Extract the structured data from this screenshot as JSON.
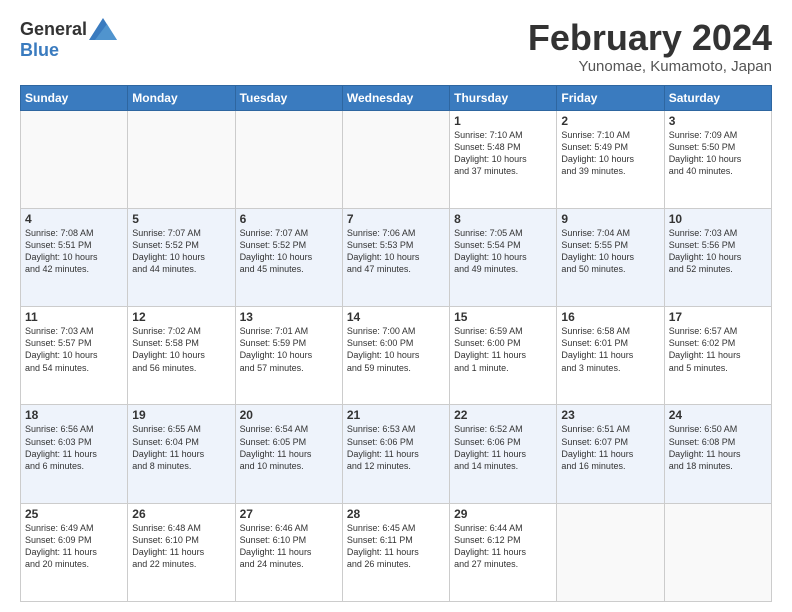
{
  "header": {
    "logo_general": "General",
    "logo_blue": "Blue",
    "title": "February 2024",
    "location": "Yunomae, Kumamoto, Japan"
  },
  "weekdays": [
    "Sunday",
    "Monday",
    "Tuesday",
    "Wednesday",
    "Thursday",
    "Friday",
    "Saturday"
  ],
  "weeks": [
    [
      {
        "day": "",
        "info": ""
      },
      {
        "day": "",
        "info": ""
      },
      {
        "day": "",
        "info": ""
      },
      {
        "day": "",
        "info": ""
      },
      {
        "day": "1",
        "info": "Sunrise: 7:10 AM\nSunset: 5:48 PM\nDaylight: 10 hours\nand 37 minutes."
      },
      {
        "day": "2",
        "info": "Sunrise: 7:10 AM\nSunset: 5:49 PM\nDaylight: 10 hours\nand 39 minutes."
      },
      {
        "day": "3",
        "info": "Sunrise: 7:09 AM\nSunset: 5:50 PM\nDaylight: 10 hours\nand 40 minutes."
      }
    ],
    [
      {
        "day": "4",
        "info": "Sunrise: 7:08 AM\nSunset: 5:51 PM\nDaylight: 10 hours\nand 42 minutes."
      },
      {
        "day": "5",
        "info": "Sunrise: 7:07 AM\nSunset: 5:52 PM\nDaylight: 10 hours\nand 44 minutes."
      },
      {
        "day": "6",
        "info": "Sunrise: 7:07 AM\nSunset: 5:52 PM\nDaylight: 10 hours\nand 45 minutes."
      },
      {
        "day": "7",
        "info": "Sunrise: 7:06 AM\nSunset: 5:53 PM\nDaylight: 10 hours\nand 47 minutes."
      },
      {
        "day": "8",
        "info": "Sunrise: 7:05 AM\nSunset: 5:54 PM\nDaylight: 10 hours\nand 49 minutes."
      },
      {
        "day": "9",
        "info": "Sunrise: 7:04 AM\nSunset: 5:55 PM\nDaylight: 10 hours\nand 50 minutes."
      },
      {
        "day": "10",
        "info": "Sunrise: 7:03 AM\nSunset: 5:56 PM\nDaylight: 10 hours\nand 52 minutes."
      }
    ],
    [
      {
        "day": "11",
        "info": "Sunrise: 7:03 AM\nSunset: 5:57 PM\nDaylight: 10 hours\nand 54 minutes."
      },
      {
        "day": "12",
        "info": "Sunrise: 7:02 AM\nSunset: 5:58 PM\nDaylight: 10 hours\nand 56 minutes."
      },
      {
        "day": "13",
        "info": "Sunrise: 7:01 AM\nSunset: 5:59 PM\nDaylight: 10 hours\nand 57 minutes."
      },
      {
        "day": "14",
        "info": "Sunrise: 7:00 AM\nSunset: 6:00 PM\nDaylight: 10 hours\nand 59 minutes."
      },
      {
        "day": "15",
        "info": "Sunrise: 6:59 AM\nSunset: 6:00 PM\nDaylight: 11 hours\nand 1 minute."
      },
      {
        "day": "16",
        "info": "Sunrise: 6:58 AM\nSunset: 6:01 PM\nDaylight: 11 hours\nand 3 minutes."
      },
      {
        "day": "17",
        "info": "Sunrise: 6:57 AM\nSunset: 6:02 PM\nDaylight: 11 hours\nand 5 minutes."
      }
    ],
    [
      {
        "day": "18",
        "info": "Sunrise: 6:56 AM\nSunset: 6:03 PM\nDaylight: 11 hours\nand 6 minutes."
      },
      {
        "day": "19",
        "info": "Sunrise: 6:55 AM\nSunset: 6:04 PM\nDaylight: 11 hours\nand 8 minutes."
      },
      {
        "day": "20",
        "info": "Sunrise: 6:54 AM\nSunset: 6:05 PM\nDaylight: 11 hours\nand 10 minutes."
      },
      {
        "day": "21",
        "info": "Sunrise: 6:53 AM\nSunset: 6:06 PM\nDaylight: 11 hours\nand 12 minutes."
      },
      {
        "day": "22",
        "info": "Sunrise: 6:52 AM\nSunset: 6:06 PM\nDaylight: 11 hours\nand 14 minutes."
      },
      {
        "day": "23",
        "info": "Sunrise: 6:51 AM\nSunset: 6:07 PM\nDaylight: 11 hours\nand 16 minutes."
      },
      {
        "day": "24",
        "info": "Sunrise: 6:50 AM\nSunset: 6:08 PM\nDaylight: 11 hours\nand 18 minutes."
      }
    ],
    [
      {
        "day": "25",
        "info": "Sunrise: 6:49 AM\nSunset: 6:09 PM\nDaylight: 11 hours\nand 20 minutes."
      },
      {
        "day": "26",
        "info": "Sunrise: 6:48 AM\nSunset: 6:10 PM\nDaylight: 11 hours\nand 22 minutes."
      },
      {
        "day": "27",
        "info": "Sunrise: 6:46 AM\nSunset: 6:10 PM\nDaylight: 11 hours\nand 24 minutes."
      },
      {
        "day": "28",
        "info": "Sunrise: 6:45 AM\nSunset: 6:11 PM\nDaylight: 11 hours\nand 26 minutes."
      },
      {
        "day": "29",
        "info": "Sunrise: 6:44 AM\nSunset: 6:12 PM\nDaylight: 11 hours\nand 27 minutes."
      },
      {
        "day": "",
        "info": ""
      },
      {
        "day": "",
        "info": ""
      }
    ]
  ]
}
